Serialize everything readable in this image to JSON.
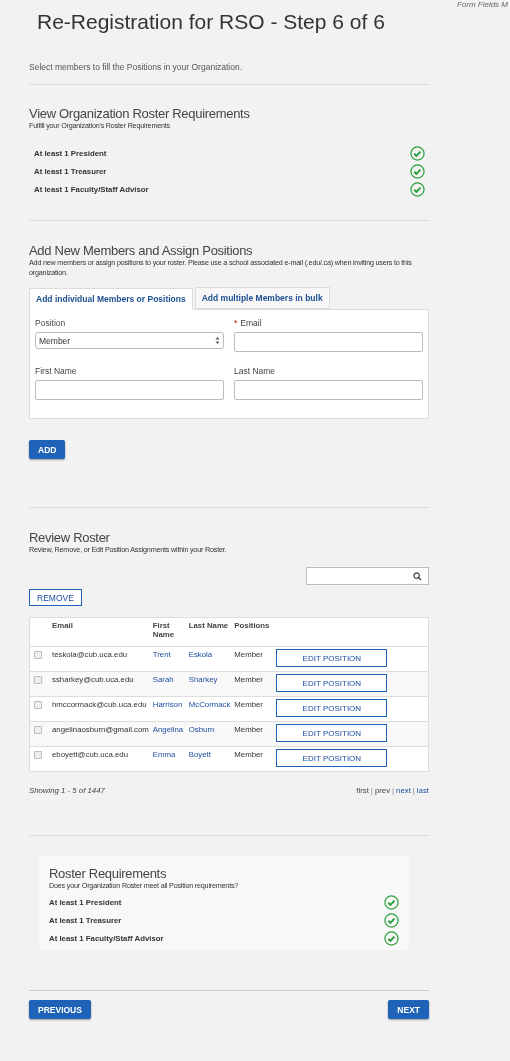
{
  "corner_note": "Form Fields M",
  "title": "Re-Registration for RSO - Step 6 of 6",
  "intro": "Select members to fill the Positions in your Organization.",
  "requirements_section": {
    "heading": "View Organization Roster Requirements",
    "subheading": "Fulfill your Organization's Roster Requirements",
    "items": [
      {
        "label": "At least 1 President",
        "met": true
      },
      {
        "label": "At least 1 Treasurer",
        "met": true
      },
      {
        "label": "At least 1 Faculty/Staff Advisor",
        "met": true
      }
    ]
  },
  "add_section": {
    "heading": "Add New Members and Assign Positions",
    "description": "Add new members or assign positions to your roster. Please use a school associated e-mail (.edu/.ca) when inviting users to this organization.",
    "tabs": [
      {
        "label": "Add individual Members or Positions",
        "selected": true
      },
      {
        "label": "Add multiple Members in bulk",
        "selected": false
      }
    ],
    "fields": [
      {
        "kind": "select",
        "label": "Position",
        "value": "Member",
        "required": false
      },
      {
        "kind": "text",
        "label": "Email",
        "required": true
      },
      {
        "kind": "text",
        "label": "First Name",
        "required": false
      },
      {
        "kind": "text",
        "label": "Last Name",
        "required": false
      }
    ],
    "required_mark": "*",
    "add_button": "ADD"
  },
  "roster": {
    "heading": "Review Roster",
    "subheading": "Review, Remove, or Edit Position Assignments within your Roster.",
    "remove_button": "REMOVE",
    "columns": [
      "Email",
      "First Name",
      "Last Name",
      "Positions"
    ],
    "rows": [
      {
        "checked": false,
        "email": "teskola@cub.uca.edu",
        "first": "Trent",
        "last": "Eskola",
        "position": "Member",
        "action": "EDIT POSITION"
      },
      {
        "checked": false,
        "email": "ssharkey@cub.uca.edu",
        "first": "Sarah",
        "last": "Sharkey",
        "position": "Member",
        "action": "EDIT POSITION"
      },
      {
        "checked": false,
        "email": "hmccormack@cub.uca.edu",
        "first": "Harrison",
        "last": "McCormack",
        "position": "Member",
        "action": "EDIT POSITION"
      },
      {
        "checked": false,
        "email": "angelinaosburn@gmail.com",
        "first": "Angelina",
        "last": "Osburn",
        "position": "Member",
        "action": "EDIT POSITION"
      },
      {
        "checked": false,
        "email": "eboyett@cub.uca.edu",
        "first": "Emma",
        "last": "Boyett",
        "position": "Member",
        "action": "EDIT POSITION"
      }
    ],
    "showing": "Showing 1 - 5 of 1447",
    "pager": [
      {
        "kind": "link",
        "text": "first"
      },
      {
        "kind": "separator",
        "text": "|"
      },
      {
        "kind": "link",
        "text": "prev"
      },
      {
        "kind": "separator",
        "text": "|"
      },
      {
        "kind": "link",
        "text": "next"
      },
      {
        "kind": "separator",
        "text": "|"
      },
      {
        "kind": "link",
        "text": "last"
      }
    ]
  },
  "summary": {
    "heading": "Roster Requirements",
    "subheading": "Does your Organization Roster meet all Position requirements?",
    "items": [
      {
        "label": "At least 1 President",
        "met": true
      },
      {
        "label": "At least 1 Treasurer",
        "met": true
      },
      {
        "label": "At least 1 Faculty/Staff Advisor",
        "met": true
      }
    ]
  },
  "buttons": {
    "previous": "PREVIOUS",
    "next": "NEXT"
  }
}
